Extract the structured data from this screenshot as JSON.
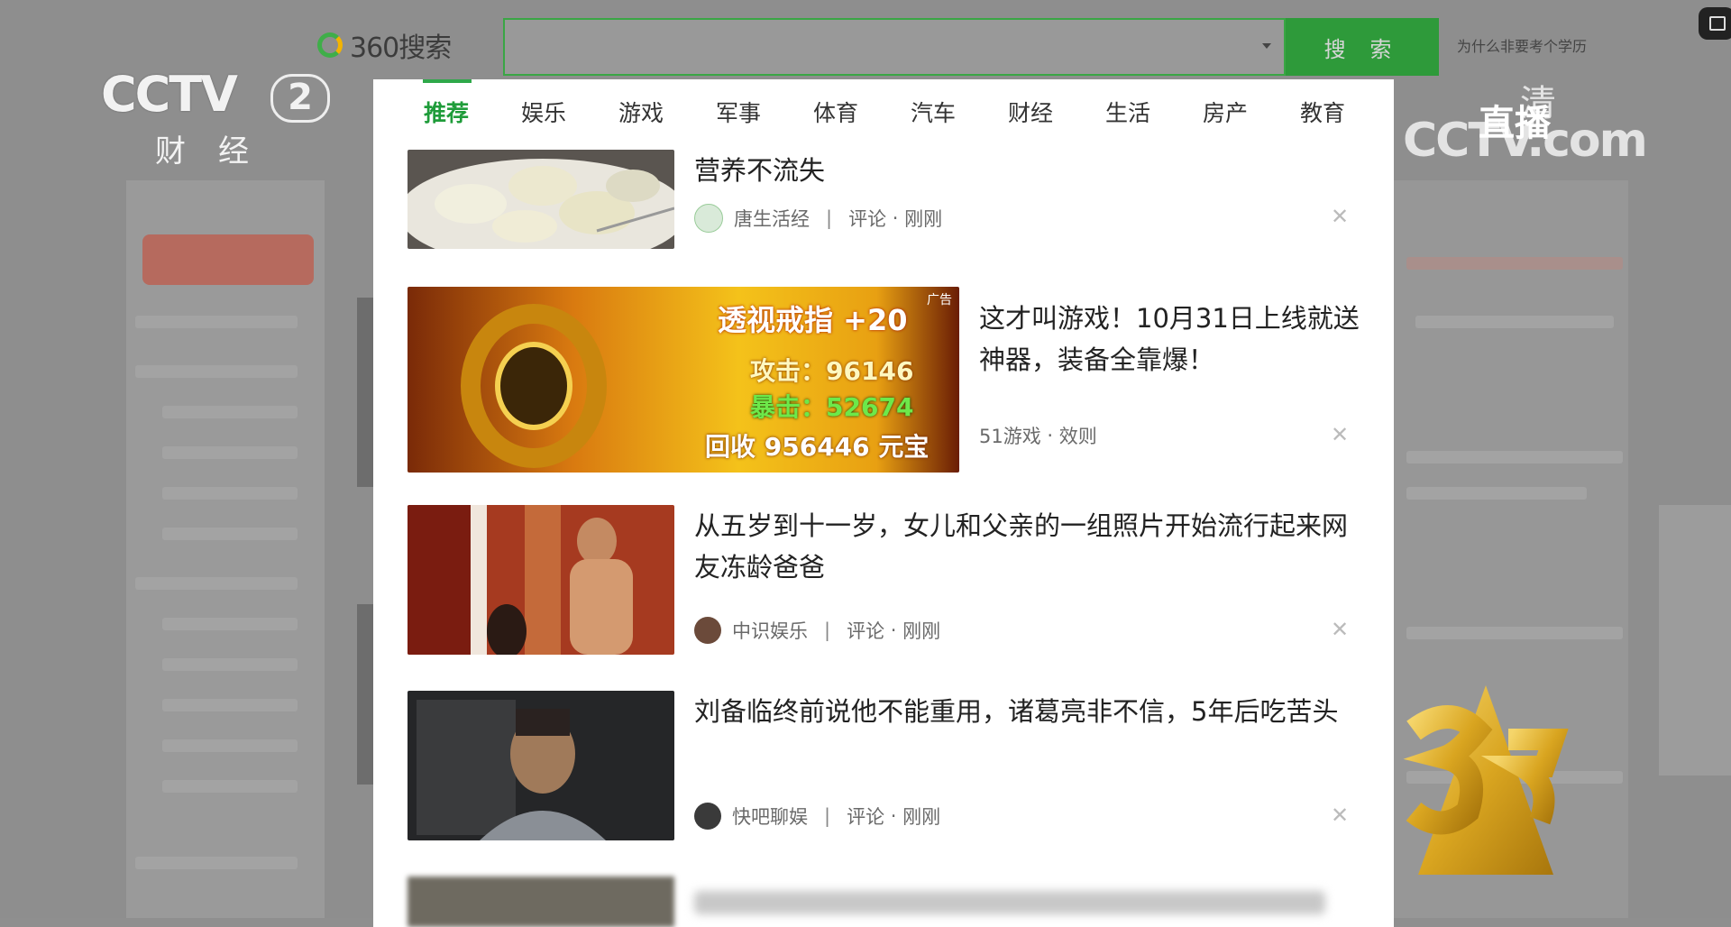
{
  "watermark": {
    "channel_mark": "CCTV",
    "channel_number": "2",
    "channel_name": "财经",
    "live_label": "直播",
    "hd_label": "清",
    "site_mark": "CCTV.com"
  },
  "search": {
    "logo_text": "360搜索",
    "button_label": "搜 索",
    "hint_link": "为什么非要考个学历",
    "query_value": ""
  },
  "tabs": [
    "推荐",
    "娱乐",
    "游戏",
    "军事",
    "体育",
    "汽车",
    "财经",
    "生活",
    "房产",
    "教育"
  ],
  "active_tab": "推荐",
  "feed": [
    {
      "title": "营养不流失",
      "source": "唐生活经",
      "comments": "评论",
      "time": "刚刚"
    },
    {
      "title": "这才叫游戏！10月31日上线就送神器，装备全靠爆！",
      "source": "51游戏",
      "tag": "效则",
      "ad": {
        "corner": "广告",
        "line1": "透视戒指 +20",
        "line2_label": "攻击：",
        "line2_value": "96146",
        "line3_label": "暴击：",
        "line3_value": "52674",
        "line4": "回收 956446 元宝"
      }
    },
    {
      "title": "从五岁到十一岁，女儿和父亲的一组照片开始流行起来网友冻龄爸爸",
      "source": "中识娱乐",
      "comments": "评论",
      "time": "刚刚"
    },
    {
      "title": "刘备临终前说他不能重用，诸葛亮非不信，5年后吃苦头",
      "source": "快吧聊娱",
      "comments": "评论",
      "time": "刚刚"
    }
  ],
  "colors": {
    "accent": "#2fa84a",
    "active_tab": "#1f9c3a",
    "search_button": "#2e9a3a",
    "page_dim": "#8f8f8f"
  }
}
